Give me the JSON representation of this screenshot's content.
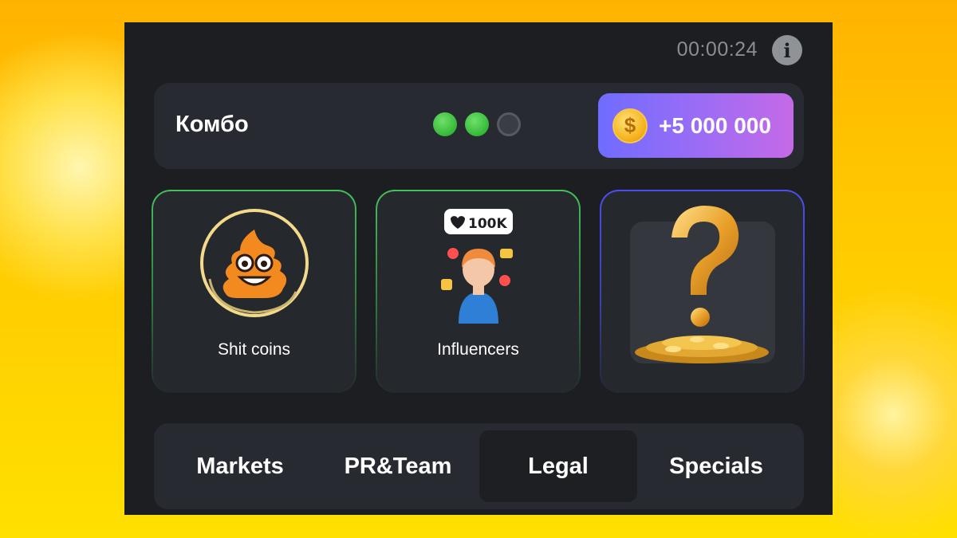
{
  "header": {
    "timer": "00:00:24",
    "info_icon": "info-icon"
  },
  "combo": {
    "title": "Комбо",
    "progress": {
      "found": 2,
      "total": 3
    },
    "reward": "+5 000 000",
    "reward_icon": "coin-icon"
  },
  "cards": [
    {
      "label": "Shit coins",
      "icon": "poop-emoji-icon",
      "border": "#46c05a"
    },
    {
      "label": "Influencers",
      "icon": "influencer-icon",
      "badge": "100K",
      "border": "#46c05a"
    },
    {
      "label": "",
      "icon": "question-mark-coins-icon",
      "border": "#4b4ff0"
    }
  ],
  "tabs": [
    {
      "label": "Markets",
      "active": false
    },
    {
      "label": "PR&Team",
      "active": false
    },
    {
      "label": "Legal",
      "active": true
    },
    {
      "label": "Specials",
      "active": false
    }
  ],
  "colors": {
    "accent_green": "#34b837",
    "reward_start": "#6f6cff",
    "reward_end": "#c56ae6",
    "panel": "#272a30"
  }
}
